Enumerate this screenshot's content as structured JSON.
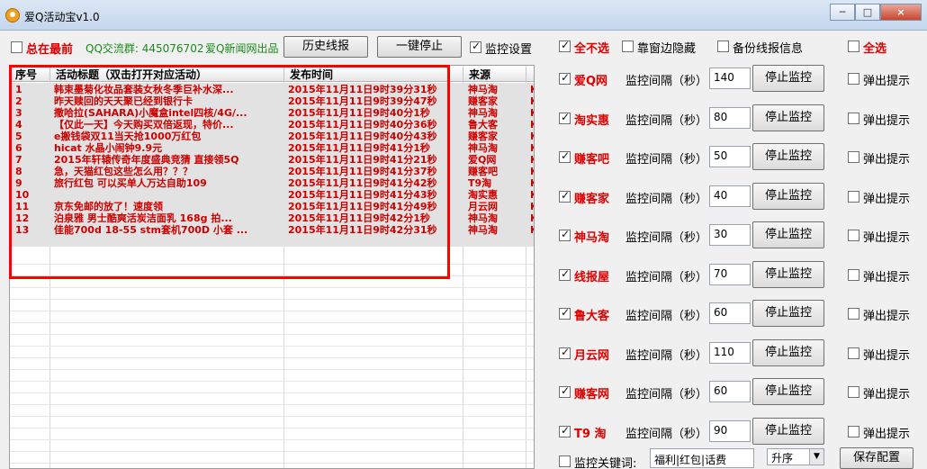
{
  "window": {
    "title": "爱Q活动宝v1.0",
    "controls": [
      "─",
      "□",
      "×"
    ]
  },
  "toolbar": {
    "always_on_top": {
      "label": "总在最前",
      "checked": false
    },
    "qq_group": "QQ交流群: 445076702",
    "publisher": "爱Q新闻网出品",
    "history_button": "历史线报",
    "stop_all_button": "一键停止",
    "monitor_settings": {
      "label": "监控设置",
      "checked": true
    }
  },
  "options": {
    "select_none": {
      "label": "全不选",
      "checked": true
    },
    "dock_hide": {
      "label": "靠窗边隐藏",
      "checked": false
    },
    "backup": {
      "label": "备份线报信息",
      "checked": false
    },
    "select_all": {
      "label": "全选",
      "checked": false
    }
  },
  "table": {
    "headers": [
      "序号",
      "活动标题（双击打开对应活动）",
      "发布时间",
      "来源"
    ],
    "rows": [
      [
        "1",
        "韩束墨菊化妆品套装女秋冬季巨补水深...",
        "2015年11月11日9时39分31秒",
        "神马淘",
        "K"
      ],
      [
        "2",
        "昨天赎回的天天聚已经到银行卡",
        "2015年11月11日9时39分47秒",
        "赚客家",
        "K"
      ],
      [
        "3",
        "撒哈拉(SAHARA)小魔盒intel四核/4G/...",
        "2015年11月11日9时40分1秒",
        "神马淘",
        "K"
      ],
      [
        "4",
        "【仅此一天】今天购买双倍返现，特价...",
        "2015年11月11日9时40分36秒",
        "鲁大客",
        "K"
      ],
      [
        "5",
        "e搬钱袋双11当天抢1000万红包",
        "2015年11月11日9时40分43秒",
        "赚客家",
        "K"
      ],
      [
        "6",
        "hicat 水晶小闹钟9.9元",
        "2015年11月11日9时41分1秒",
        "神马淘",
        "K"
      ],
      [
        "7",
        "2015年轩辕传奇年度盛典竞猜 直接领5Q",
        "2015年11月11日9时41分21秒",
        "爱Q网",
        "K"
      ],
      [
        "8",
        "急，天猫红包这些怎么用？？？",
        "2015年11月11日9时41分37秒",
        "赚客吧",
        "K"
      ],
      [
        "9",
        "旅行红包 可以买单人万达自助109",
        "2015年11月11日9时41分42秒",
        "T9淘",
        "K"
      ],
      [
        "10",
        "",
        "2015年11月11日9时41分43秒",
        "淘实惠",
        "K"
      ],
      [
        "11",
        "京东免邮的放了！速度领",
        "2015年11月11日9时41分49秒",
        "月云网",
        "K"
      ],
      [
        "12",
        "泊泉雅 男士酷爽活炭洁面乳 168g 拍...",
        "2015年11月11日9时42分1秒",
        "神马淘",
        "K"
      ],
      [
        "13",
        "佳能700d 18-55 stm套机700D 小套 ...",
        "2015年11月11日9时42分31秒",
        "神马淘",
        "K"
      ]
    ]
  },
  "monitors": {
    "interval_label": "监控间隔（秒）",
    "stop_label": "停止监控",
    "popup_label": "弹出提示",
    "items": [
      {
        "site": "爱Q网",
        "interval": "140",
        "checked": true
      },
      {
        "site": "淘实惠",
        "interval": "80",
        "checked": true
      },
      {
        "site": "赚客吧",
        "interval": "50",
        "checked": true
      },
      {
        "site": "赚客家",
        "interval": "40",
        "checked": true
      },
      {
        "site": "神马淘",
        "interval": "30",
        "checked": true
      },
      {
        "site": "线报屋",
        "interval": "70",
        "checked": true
      },
      {
        "site": "鲁大客",
        "interval": "60",
        "checked": true
      },
      {
        "site": "月云网",
        "interval": "110",
        "checked": true
      },
      {
        "site": "赚客网",
        "interval": "60",
        "checked": true
      },
      {
        "site": "T9 淘",
        "interval": "90",
        "checked": true
      }
    ]
  },
  "keywords": {
    "label": "监控关键词:",
    "value": "福利|红包|话费",
    "sort_value": "升序",
    "save_button": "保存配置"
  },
  "colors": {
    "accent_red": "#e00000",
    "highlight_box": "#ff0000",
    "group_green": "#1a8a1a"
  }
}
